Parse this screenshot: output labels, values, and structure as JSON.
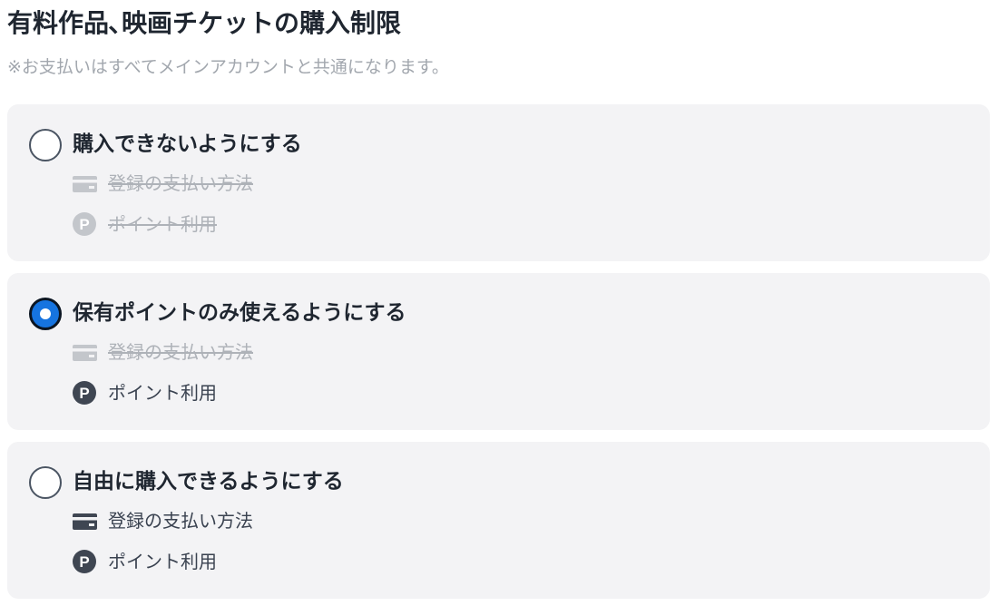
{
  "header": {
    "title": "有料作品､映画チケットの購入制限",
    "note": "※お支払いはすべてメインアカウントと共通になります。"
  },
  "options": [
    {
      "label": "購入できないようにする",
      "selected": false,
      "features": [
        {
          "icon": "credit-card-icon",
          "label": "登録の支払い方法",
          "enabled": false
        },
        {
          "icon": "points-icon",
          "label": "ポイント利用",
          "enabled": false
        }
      ]
    },
    {
      "label": "保有ポイントのみ使えるようにする",
      "selected": true,
      "features": [
        {
          "icon": "credit-card-icon",
          "label": "登録の支払い方法",
          "enabled": false
        },
        {
          "icon": "points-icon",
          "label": "ポイント利用",
          "enabled": true
        }
      ]
    },
    {
      "label": "自由に購入できるようにする",
      "selected": false,
      "features": [
        {
          "icon": "credit-card-icon",
          "label": "登録の支払い方法",
          "enabled": true
        },
        {
          "icon": "points-icon",
          "label": "ポイント利用",
          "enabled": true
        }
      ]
    }
  ],
  "colors": {
    "accent": "#1674e0",
    "card_background": "#f3f3f5",
    "disabled_text": "#aeb2b8",
    "enabled_text": "#3a4250",
    "title_text": "#1f2630",
    "note_text": "#a2a7ae"
  }
}
